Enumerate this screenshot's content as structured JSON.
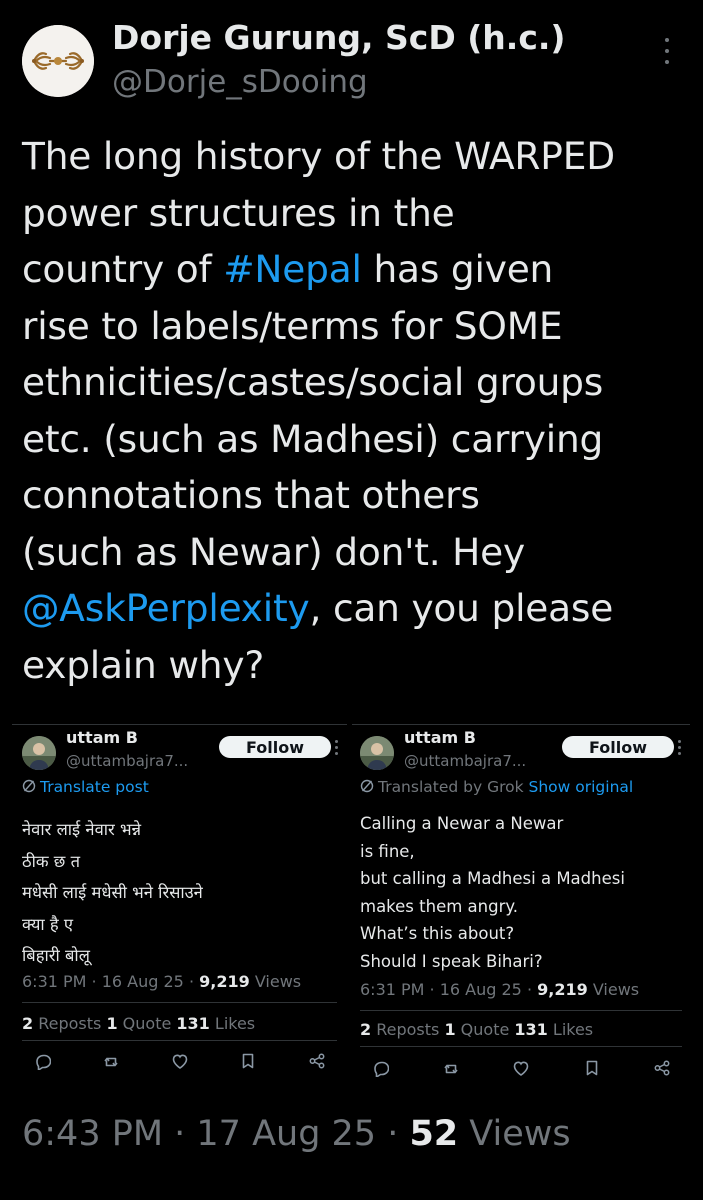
{
  "author": {
    "display_name": "Dorje Gurung, ScD (h.c.)",
    "handle": "@Dorje_sDooing",
    "avatar_icon": "vajra-icon"
  },
  "tweet": {
    "lines": [
      {
        "parts": [
          {
            "text": "The long history of the WARPED"
          }
        ]
      },
      {
        "parts": [
          {
            "text": "power structures in the"
          }
        ]
      },
      {
        "parts": [
          {
            "text": "country of "
          },
          {
            "text": "#Nepal",
            "link": true
          },
          {
            "text": " has given"
          }
        ]
      },
      {
        "parts": [
          {
            "text": "rise to labels/terms for SOME"
          }
        ]
      },
      {
        "parts": [
          {
            "text": "ethnicities/castes/social groups"
          }
        ]
      },
      {
        "parts": [
          {
            "text": "etc. (such as Madhesi) carrying"
          }
        ]
      },
      {
        "parts": [
          {
            "text": "connotations that others"
          }
        ]
      },
      {
        "parts": [
          {
            "text": "(such as Newar) don't. Hey"
          }
        ]
      },
      {
        "parts": [
          {
            "text": "@AskPerplexity",
            "link": true
          },
          {
            "text": ", can you please"
          }
        ]
      },
      {
        "parts": [
          {
            "text": "explain why?"
          }
        ]
      }
    ]
  },
  "embeds": [
    {
      "name": "uttam B",
      "handle": "@uttambajra7...",
      "follow_label": "Follow",
      "translate_icon": "translate-icon",
      "translate_text": "Translate post",
      "translate_link": "",
      "body_lines": [
        "नेवार लाई नेवार भन्ने",
        "ठीक छ त",
        "मधेसी लाई मधेसी भने रिसाउने",
        "क्या है ए",
        "बिहारी बोलू"
      ],
      "time": "6:31 PM · 16 Aug 25 · ",
      "views_count": "9,219",
      "views_label": " Views",
      "reposts_count": "2",
      "reposts_label": " Reposts ",
      "quotes_count": "1",
      "quotes_label": " Quote ",
      "likes_count": "131",
      "likes_label": " Likes"
    },
    {
      "name": "uttam B",
      "handle": "@uttambajra7...",
      "follow_label": "Follow",
      "translate_icon": "translate-icon",
      "translate_text": "Translated by Grok ",
      "translate_link": "Show original",
      "body_lines": [
        "Calling a Newar a Newar",
        "is fine,",
        "but calling a Madhesi a Madhesi",
        "makes them angry.",
        "What’s this about?",
        "Should I speak Bihari?"
      ],
      "time": "6:31 PM · 16 Aug 25 · ",
      "views_count": "9,219",
      "views_label": " Views",
      "reposts_count": "2",
      "reposts_label": " Reposts ",
      "quotes_count": "1",
      "quotes_label": " Quote ",
      "likes_count": "131",
      "likes_label": " Likes"
    }
  ],
  "footer": {
    "time": "6:43 PM · 17 Aug 25 · ",
    "views_count": "52",
    "views_label": " Views"
  },
  "colors": {
    "background": "#000000",
    "text": "#e7e9ea",
    "secondary": "#71767b",
    "link": "#1d9bf0"
  }
}
